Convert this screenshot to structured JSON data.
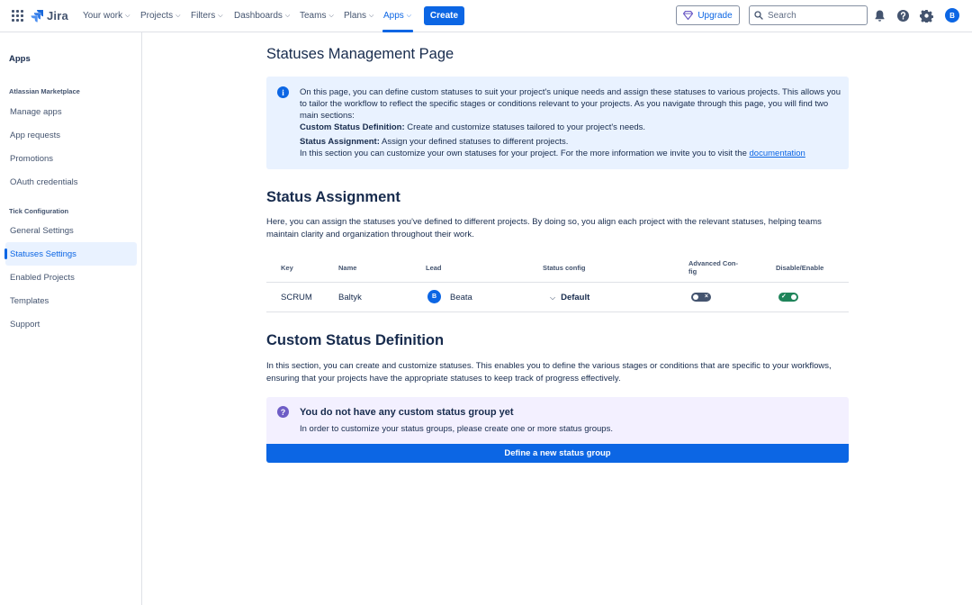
{
  "topnav": {
    "logo_text": "Jira",
    "items": [
      {
        "label": "Your work"
      },
      {
        "label": "Projects"
      },
      {
        "label": "Filters"
      },
      {
        "label": "Dashboards"
      },
      {
        "label": "Teams"
      },
      {
        "label": "Plans"
      },
      {
        "label": "Apps"
      }
    ],
    "active_item": "Apps",
    "create_label": "Create",
    "upgrade_label": "Upgrade",
    "search_placeholder": "Search",
    "avatar_initial": "B",
    "accent_color": "#0c66e4",
    "icons": [
      "app-switcher-icon",
      "notifications-icon",
      "help-icon",
      "settings-icon"
    ]
  },
  "sidebar": {
    "title": "Apps",
    "sections": [
      {
        "label": "Atlassian Marketplace",
        "items": [
          {
            "label": "Manage apps"
          },
          {
            "label": "App requests"
          },
          {
            "label": "Promotions"
          },
          {
            "label": "OAuth credentials"
          }
        ]
      },
      {
        "label": "Tick Configuration",
        "items": [
          {
            "label": "General Settings"
          },
          {
            "label": "Statuses Settings"
          },
          {
            "label": "Enabled Projects"
          },
          {
            "label": "Templates"
          },
          {
            "label": "Support"
          }
        ]
      }
    ],
    "selected_item": "Statuses Settings"
  },
  "main": {
    "page_title": "Statuses Management Page",
    "info": {
      "intro": "On this page, you can define custom statuses to suit your project's unique needs and assign these statuses to various projects. This allows you to tailor the workflow to reflect the specific stages or conditions relevant to your projects. As you navigate through this page, you will find two main sections:",
      "def_label": "Custom Status Definition:",
      "def_text": "Create and customize statuses tailored to your project's needs.",
      "assign_label": "Status Assignment:",
      "assign_text": "Assign your defined statuses to different projects.",
      "outro": "In this section you can customize your own statuses for your project. For the more information we invite you to visit the",
      "link_text": "documentation"
    },
    "assignment": {
      "heading": "Status Assignment",
      "description": "Here, you can assign the statuses you've defined to different projects. By doing so, you align each project with the relevant statuses, helping teams maintain clarity and organization throughout their work.",
      "columns": {
        "key": "Key",
        "name": "Name",
        "lead": "Lead",
        "status_config": "Status config",
        "advanced_config_1": "Advanced Con-",
        "advanced_config_2": "fig",
        "disable_enable": "Disable/Enable"
      },
      "rows": [
        {
          "key": "SCRUM",
          "name": "Baltyk",
          "lead": "Beata",
          "lead_initial": "B",
          "status_config": "Default",
          "advanced_config": false,
          "enabled": true
        }
      ]
    },
    "definition": {
      "heading": "Custom Status Definition",
      "description": "In this section, you can create and customize statuses. This enables you to define the various stages or conditions that are specific to your workflows, ensuring that your projects have the appropriate statuses to keep track of progress effectively.",
      "empty_title": "You do not have any custom status group yet",
      "empty_sub": "In order to customize your status groups, please create one or more status groups.",
      "button_label": "Define a new status group"
    }
  }
}
